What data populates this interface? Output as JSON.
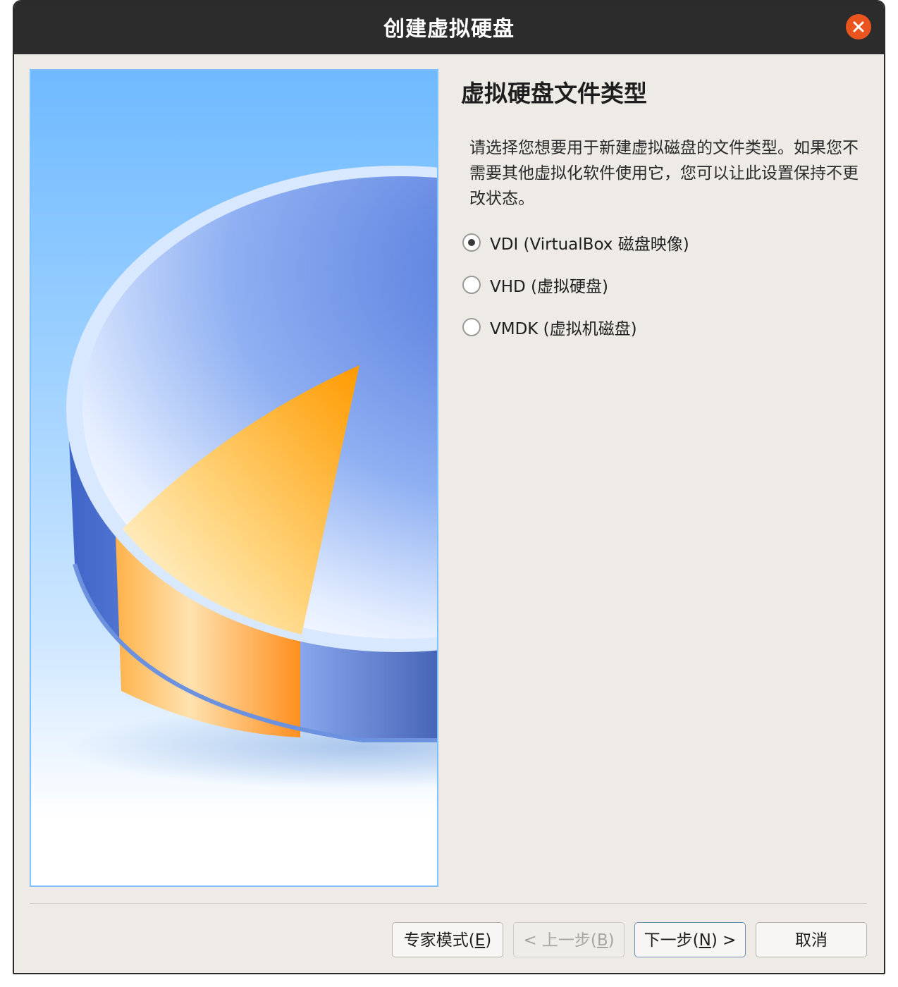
{
  "window": {
    "title": "创建虚拟硬盘",
    "close_icon": "close-icon"
  },
  "main": {
    "heading": "虚拟硬盘文件类型",
    "description": "请选择您想要用于新建虚拟磁盘的文件类型。如果您不需要其他虚拟化软件使用它，您可以让此设置保持不更改状态。",
    "options": [
      {
        "label": "VDI (VirtualBox 磁盘映像)",
        "checked": true
      },
      {
        "label": "VHD (虚拟硬盘)",
        "checked": false
      },
      {
        "label": "VMDK (虚拟机磁盘)",
        "checked": false
      }
    ]
  },
  "buttons": {
    "expert_prefix": "专家模式(",
    "expert_key": "E",
    "expert_suffix": ")",
    "back_prefix": "< 上一步(",
    "back_key": "B",
    "back_suffix": ")",
    "next_prefix": "下一步(",
    "next_key": "N",
    "next_suffix": ") >",
    "cancel": "取消"
  },
  "colors": {
    "titlebar": "#2c2c2c",
    "close_button": "#e9541f",
    "window_bg": "#eeebe6",
    "accent_orange": "#ff9b1a",
    "disk_blue": "#4f73d6"
  }
}
